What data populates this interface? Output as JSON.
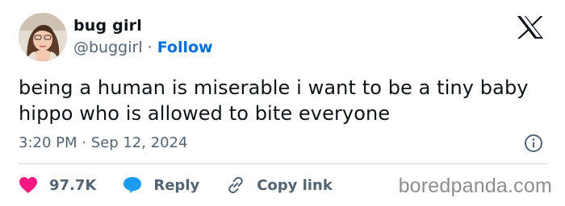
{
  "author": {
    "display_name": "bug girl",
    "handle": "@buggirl",
    "separator": " · ",
    "follow_label": "Follow"
  },
  "tweet": {
    "text": "being a human is miserable i want to be a tiny baby hippo who is allowed to bite everyone",
    "timestamp": "3:20 PM · Sep 12, 2024"
  },
  "actions": {
    "like_count": "97.7K",
    "reply_label": "Reply",
    "copy_link_label": "Copy link"
  },
  "watermark": "boredpanda.com",
  "icons": {
    "logo": "x-logo-icon",
    "info": "info-icon",
    "like": "heart-icon",
    "reply": "speech-bubble-icon",
    "copy": "link-icon"
  },
  "colors": {
    "text": "#0f1419",
    "secondary": "#536471",
    "follow": "#006fd6",
    "like": "#f91880",
    "reply": "#1d9bf0",
    "divider": "#cfd9de",
    "watermark": "#8e8e8e"
  }
}
